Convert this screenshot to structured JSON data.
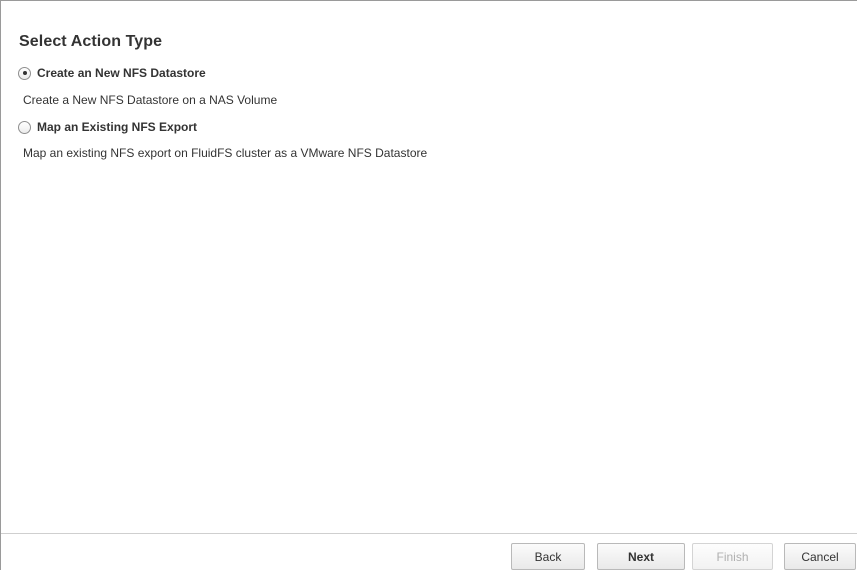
{
  "wizard": {
    "title": "Select Action Type",
    "options": [
      {
        "label": "Create an New NFS Datastore",
        "description": "Create a New NFS Datastore on a NAS Volume",
        "selected": true
      },
      {
        "label": "Map an Existing NFS Export",
        "description": "Map an existing NFS export on FluidFS cluster as a VMware NFS Datastore",
        "selected": false
      }
    ]
  },
  "footer": {
    "back_label": "Back",
    "next_label": "Next",
    "finish_label": "Finish",
    "finish_disabled": true,
    "cancel_label": "Cancel"
  }
}
